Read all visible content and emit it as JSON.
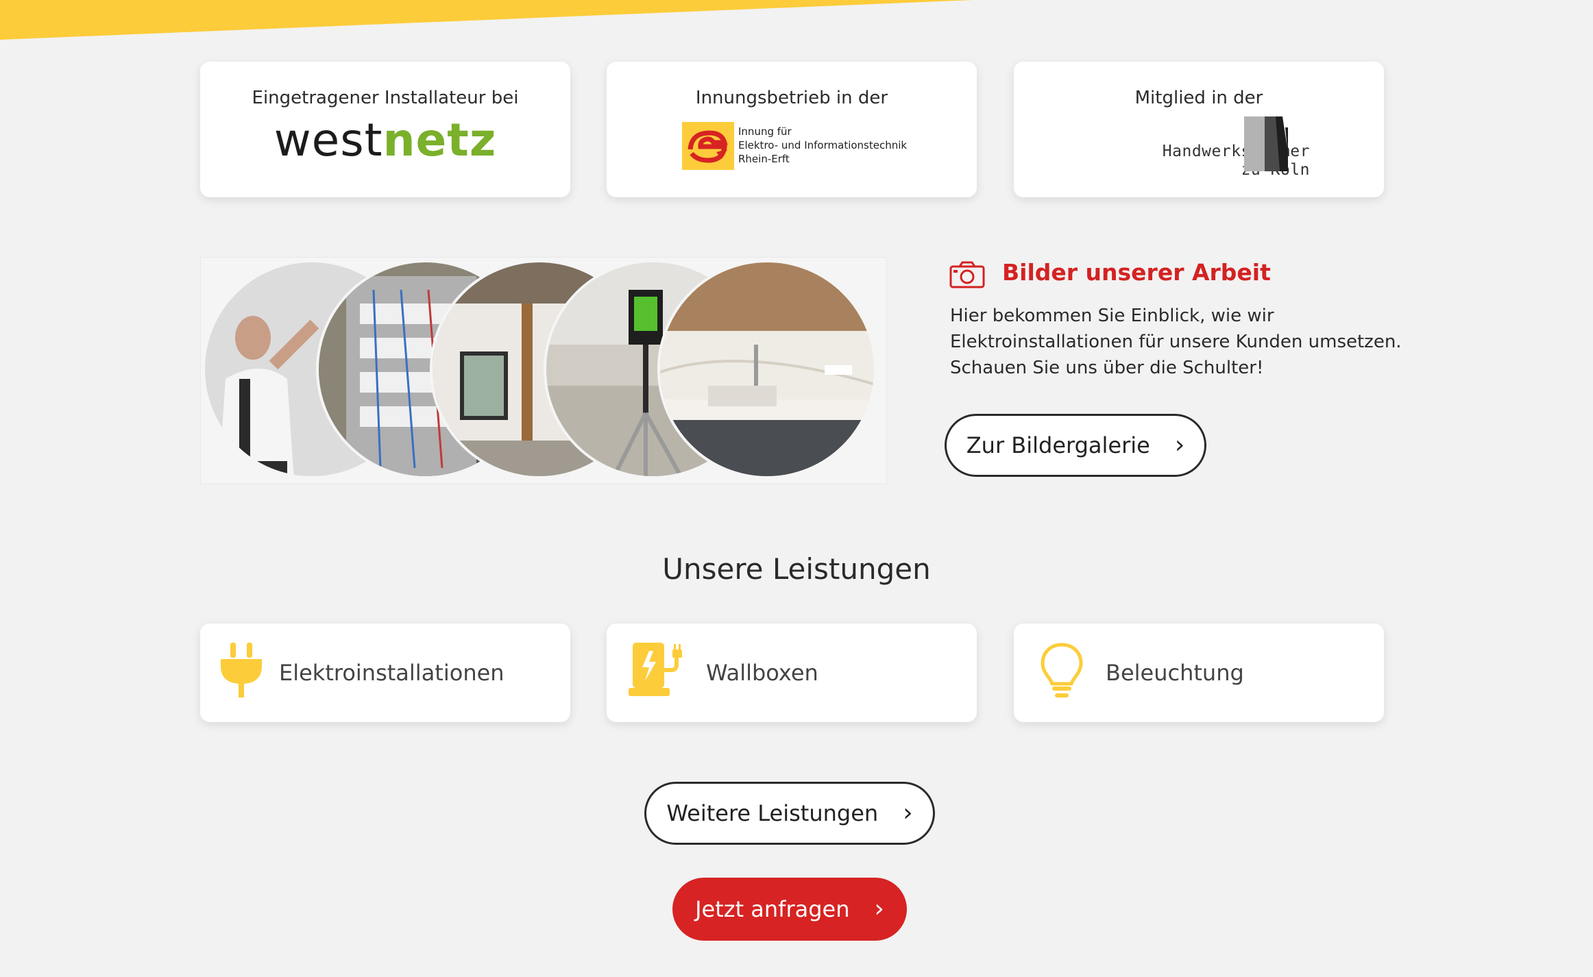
{
  "colors": {
    "accent_yellow": "#fccc3a",
    "accent_red": "#d72323",
    "westnetz_green": "#7ab02a",
    "background": "#f2f2f2"
  },
  "partners": {
    "westnetz": {
      "caption": "Eingetragener Installateur bei",
      "logo_west": "west",
      "logo_netz": "netz"
    },
    "innung": {
      "caption": "Innungsbetrieb in der",
      "logo_line1": "Innung für",
      "logo_line2": "Elektro- und Informationstechnik",
      "logo_line3": "Rhein-Erft"
    },
    "hwk": {
      "caption": "Mitglied in der",
      "logo_line1": "Handwerkskammer",
      "logo_line2": "zu Köln"
    }
  },
  "gallery": {
    "title": "Bilder unserer Arbeit",
    "text": "Hier bekommen Sie Einblick, wie wir Elektroinstallationen für unsere Kunden umsetzen. Schauen Sie uns über die Schulter!",
    "button_label": "Zur Bildergalerie",
    "photos": [
      "electrician-portrait",
      "distribution-panel",
      "room-renovation",
      "laser-level-on-tripod",
      "kitchen-counter"
    ]
  },
  "services": {
    "title": "Unsere Leistungen",
    "items": [
      {
        "label": "Elektroinstallationen",
        "icon": "plug-icon"
      },
      {
        "label": "Wallboxen",
        "icon": "ev-charger-icon"
      },
      {
        "label": "Beleuchtung",
        "icon": "lightbulb-icon"
      }
    ],
    "more_label": "Weitere Leistungen"
  },
  "cta": {
    "label": "Jetzt anfragen"
  },
  "chevron": "›"
}
